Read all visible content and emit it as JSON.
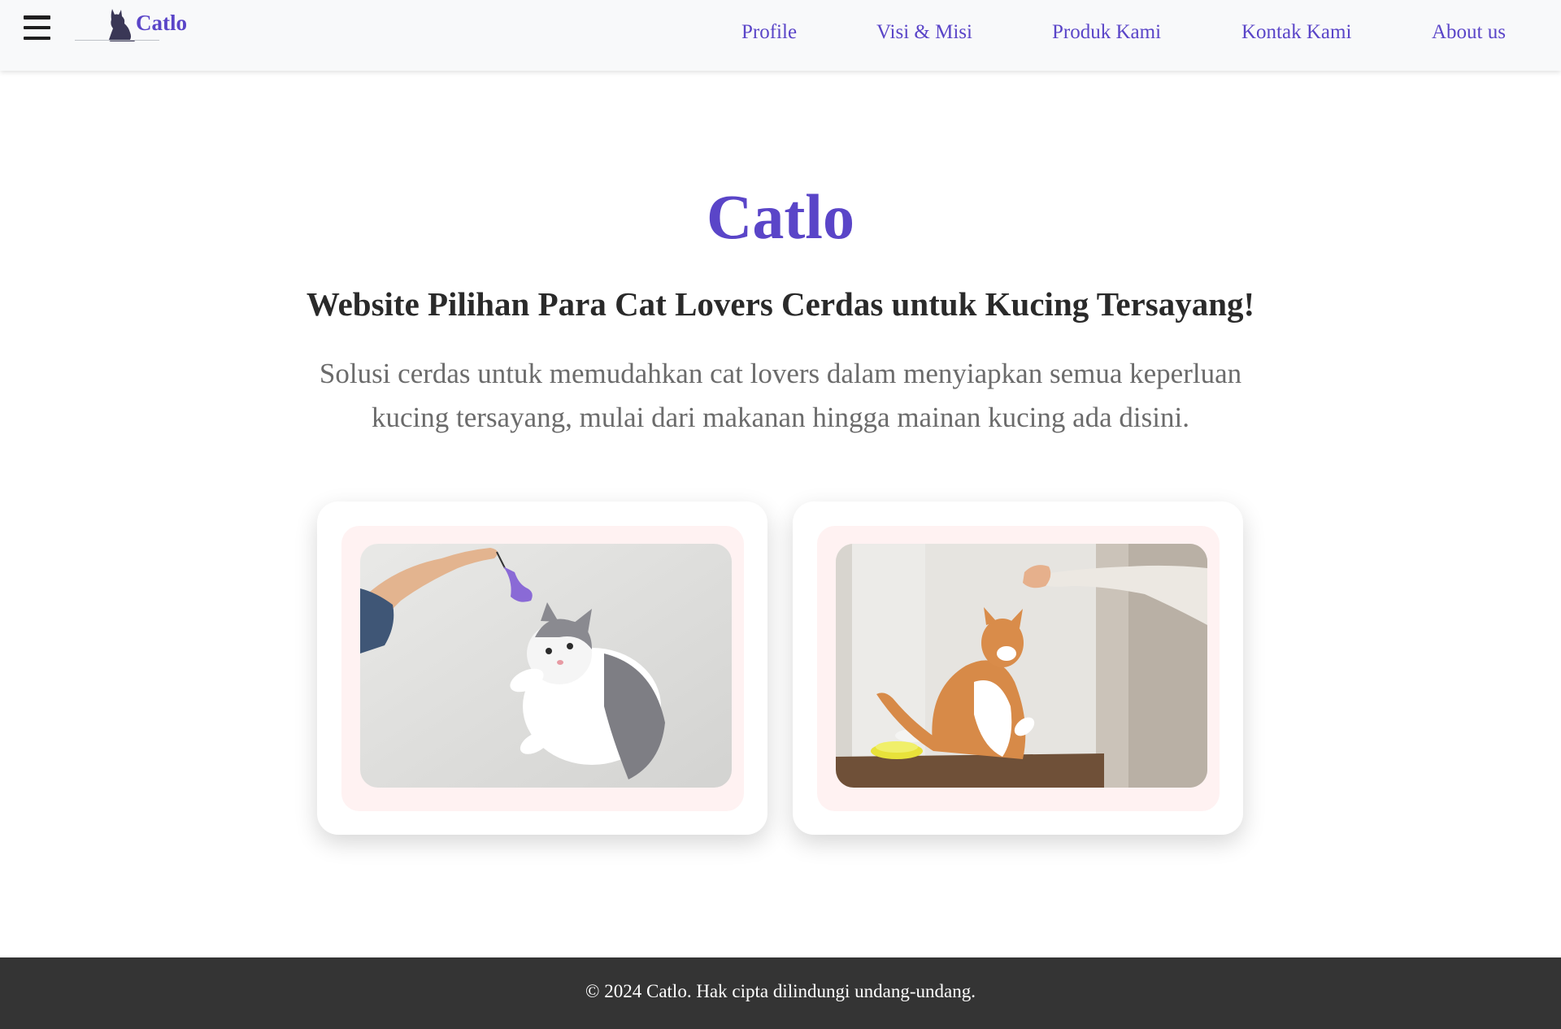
{
  "navbar": {
    "brand_name": "Catlo",
    "menu_icon": "hamburger-menu-icon",
    "logo_icon": "cat-silhouette-icon",
    "links": [
      {
        "label": "Profile"
      },
      {
        "label": "Visi & Misi"
      },
      {
        "label": "Produk Kami"
      },
      {
        "label": "Kontak Kami"
      },
      {
        "label": "About us"
      }
    ]
  },
  "hero": {
    "title": "Catlo",
    "subtitle": "Website Pilihan Para Cat Lovers Cerdas untuk Kucing Tersayang!",
    "description": "Solusi cerdas untuk memudahkan cat lovers dalam menyiapkan semua keperluan kucing tersayang, mulai dari makanan hingga mainan kucing ada disini."
  },
  "gallery": {
    "images": [
      {
        "depicts": "grey-and-white cat jumping at a purple feather toy held by a hand"
      },
      {
        "depicts": "orange-and-white cat reaching up toward a hand above a yellow food bowl"
      }
    ]
  },
  "footer": {
    "copyright": "© 2024 Catlo. Hak cipta dilindungi undang-undang."
  },
  "colors": {
    "brand": "#5a45c8",
    "navbar_bg": "#f8f9fa",
    "card_inner_bg": "#fff2f2",
    "footer_bg": "#343434",
    "subtitle_text": "#2a2a2a",
    "description_text": "#6b6b6b"
  }
}
